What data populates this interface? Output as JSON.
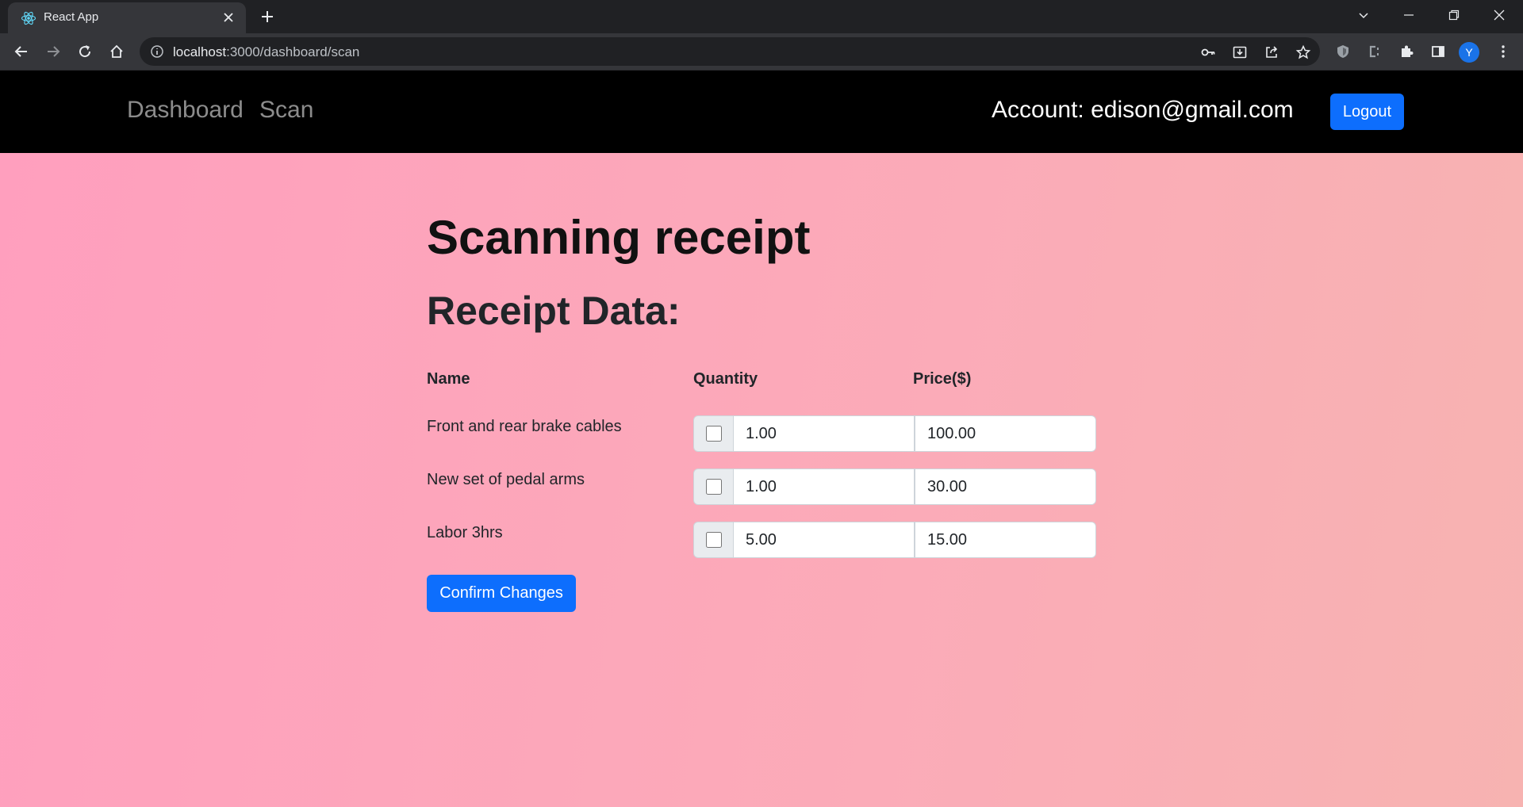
{
  "browser": {
    "tab_title": "React App",
    "url_host": "localhost",
    "url_rest": ":3000/dashboard/scan",
    "profile_initial": "Y"
  },
  "navbar": {
    "links": [
      "Dashboard",
      "Scan"
    ],
    "account": "Account: edison@gmail.com",
    "logout_label": "Logout"
  },
  "page": {
    "title": "Scanning receipt",
    "subtitle": "Receipt Data:",
    "columns": {
      "name": "Name",
      "quantity": "Quantity",
      "price": "Price($)"
    },
    "items": [
      {
        "name": "Front and rear brake cables",
        "checked": false,
        "quantity": "1.00",
        "price": "100.00"
      },
      {
        "name": "New set of pedal arms",
        "checked": false,
        "quantity": "1.00",
        "price": "30.00"
      },
      {
        "name": "Labor 3hrs",
        "checked": false,
        "quantity": "5.00",
        "price": "15.00"
      }
    ],
    "confirm_label": "Confirm Changes"
  },
  "colors": {
    "navbar_bg": "#000000",
    "primary": "#0d6efd",
    "background_gradient": [
      "#ff9fbe",
      "#f7b3b1"
    ]
  }
}
